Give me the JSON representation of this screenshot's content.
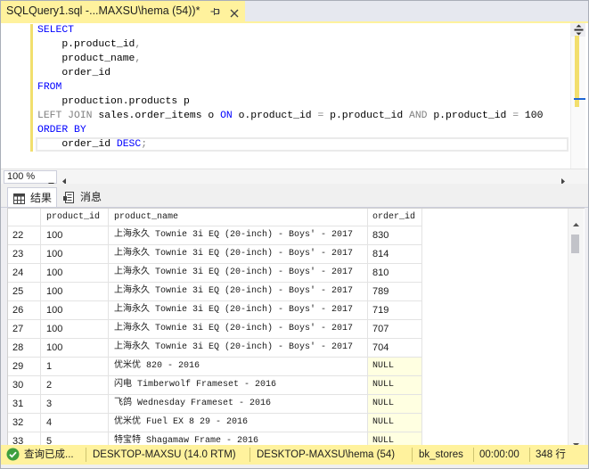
{
  "document_tab": {
    "title": "SQLQuery1.sql -...MAXSU\\hema (54))*",
    "pin_icon": "pin-icon",
    "close_icon": "close-icon"
  },
  "editor": {
    "lines": [
      [
        "SELECT"
      ],
      [
        "    p.product_id",
        ","
      ],
      [
        "    product_name",
        ","
      ],
      [
        "    order_id"
      ],
      [
        "FROM"
      ],
      [
        "    production.products p"
      ],
      [
        "LEFT JOIN",
        " sales.order_items o ",
        "ON",
        " o.product_id ",
        "=",
        " p.product_id ",
        "AND",
        " p.product_id ",
        "=",
        " 100"
      ],
      [
        "ORDER BY"
      ],
      [
        "    order_id ",
        "DESC",
        ";"
      ]
    ],
    "split_icon": "split-window-icon"
  },
  "zoom": {
    "value": "100 %",
    "dropdown_icon": "chevron-down-icon"
  },
  "results_tabs": [
    {
      "label": "结果",
      "icon": "grid-icon"
    },
    {
      "label": "消息",
      "icon": "message-icon"
    }
  ],
  "grid": {
    "columns": [
      "product_id",
      "product_name",
      "order_id"
    ],
    "rows": [
      {
        "n": "22",
        "product_id": "100",
        "product_name": "上海永久 Townie 3i EQ (20-inch) - Boys' - 2017",
        "order_id": "830"
      },
      {
        "n": "23",
        "product_id": "100",
        "product_name": "上海永久 Townie 3i EQ (20-inch) - Boys' - 2017",
        "order_id": "814"
      },
      {
        "n": "24",
        "product_id": "100",
        "product_name": "上海永久 Townie 3i EQ (20-inch) - Boys' - 2017",
        "order_id": "810"
      },
      {
        "n": "25",
        "product_id": "100",
        "product_name": "上海永久 Townie 3i EQ (20-inch) - Boys' - 2017",
        "order_id": "789"
      },
      {
        "n": "26",
        "product_id": "100",
        "product_name": "上海永久 Townie 3i EQ (20-inch) - Boys' - 2017",
        "order_id": "719"
      },
      {
        "n": "27",
        "product_id": "100",
        "product_name": "上海永久 Townie 3i EQ (20-inch) - Boys' - 2017",
        "order_id": "707"
      },
      {
        "n": "28",
        "product_id": "100",
        "product_name": "上海永久 Townie 3i EQ (20-inch) - Boys' - 2017",
        "order_id": "704"
      },
      {
        "n": "29",
        "product_id": "1",
        "product_name": "优米优 820 - 2016",
        "order_id": "NULL"
      },
      {
        "n": "30",
        "product_id": "2",
        "product_name": "闪电 Timberwolf Frameset - 2016",
        "order_id": "NULL"
      },
      {
        "n": "31",
        "product_id": "3",
        "product_name": "飞鸽 Wednesday Frameset - 2016",
        "order_id": "NULL"
      },
      {
        "n": "32",
        "product_id": "4",
        "product_name": "优米优 Fuel EX 8 29 - 2016",
        "order_id": "NULL"
      },
      {
        "n": "33",
        "product_id": "5",
        "product_name": "特宝特 Shagamaw Frame - 2016",
        "order_id": "NULL"
      }
    ]
  },
  "status_bar": {
    "icon": "success-check-icon",
    "message": "查询已成...",
    "server": "DESKTOP-MAXSU (14.0 RTM)",
    "login": "DESKTOP-MAXSU\\hema (54)",
    "database": "bk_stores",
    "elapsed": "00:00:00",
    "row_count": "348 行"
  },
  "colors": {
    "tab": "#FFF29D",
    "kw": "#0000FF",
    "op": "#808080",
    "null": "#FFFFE1",
    "status": "#FFF29D",
    "ok": "#3E9F3E"
  }
}
